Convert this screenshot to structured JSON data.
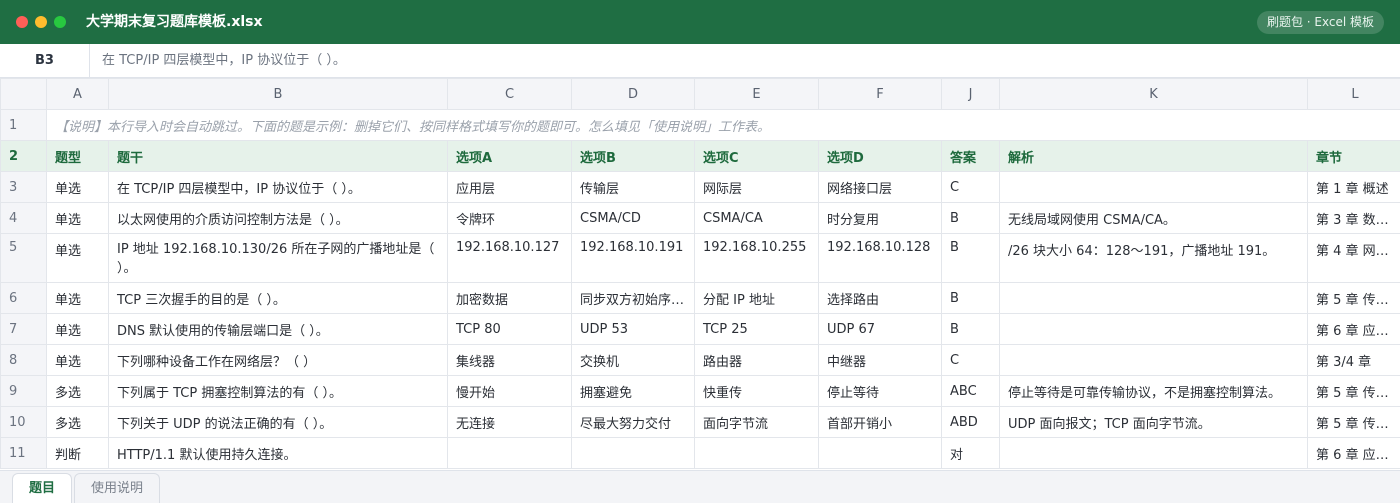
{
  "window": {
    "title": "大学期末复习题库模板.xlsx",
    "badge": "刷题包 · Excel 模板"
  },
  "formula_bar": {
    "cell_ref": "B3",
    "content": "在 TCP/IP 四层模型中，IP 协议位于（ ）。"
  },
  "columns": [
    "A",
    "B",
    "C",
    "D",
    "E",
    "F",
    "J",
    "K",
    "L"
  ],
  "note_row": {
    "num": "1",
    "text": "【说明】本行导入时会自动跳过。下面的题是示例：删掉它们、按同样格式填写你的题即可。怎么填见「使用说明」工作表。"
  },
  "header_row": {
    "num": "2",
    "cells": [
      "题型",
      "题干",
      "选项A",
      "选项B",
      "选项C",
      "选项D",
      "答案",
      "解析",
      "章节"
    ]
  },
  "rows": [
    {
      "num": "3",
      "cells": [
        "单选",
        "在 TCP/IP 四层模型中，IP 协议位于（ ）。",
        "应用层",
        "传输层",
        "网际层",
        "网络接口层",
        "C",
        "",
        "第 1 章 概述"
      ]
    },
    {
      "num": "4",
      "cells": [
        "单选",
        "以太网使用的介质访问控制方法是（ ）。",
        "令牌环",
        "CSMA/CD",
        "CSMA/CA",
        "时分复用",
        "B",
        "无线局域网使用 CSMA/CA。",
        "第 3 章 数…"
      ]
    },
    {
      "num": "5",
      "cells": [
        "单选",
        "IP 地址 192.168.10.130/26 所在子网的广播地址是（ ）。",
        "192.168.10.127",
        "192.168.10.191",
        "192.168.10.255",
        "192.168.10.128",
        "B",
        "/26 块大小 64：128～191，广播地址 191。",
        "第 4 章 网…"
      ]
    },
    {
      "num": "6",
      "cells": [
        "单选",
        "TCP 三次握手的目的是（ ）。",
        "加密数据",
        "同步双方初始序…",
        "分配 IP 地址",
        "选择路由",
        "B",
        "",
        "第 5 章 传…"
      ]
    },
    {
      "num": "7",
      "cells": [
        "单选",
        "DNS 默认使用的传输层端口是（ ）。",
        "TCP 80",
        "UDP 53",
        "TCP 25",
        "UDP 67",
        "B",
        "",
        "第 6 章 应…"
      ]
    },
    {
      "num": "8",
      "cells": [
        "单选",
        "下列哪种设备工作在网络层？（ ）",
        "集线器",
        "交换机",
        "路由器",
        "中继器",
        "C",
        "",
        "第 3/4 章"
      ]
    },
    {
      "num": "9",
      "cells": [
        "多选",
        "下列属于 TCP 拥塞控制算法的有（ ）。",
        "慢开始",
        "拥塞避免",
        "快重传",
        "停止等待",
        "ABC",
        "停止等待是可靠传输协议，不是拥塞控制算法。",
        "第 5 章 传…"
      ]
    },
    {
      "num": "10",
      "cells": [
        "多选",
        "下列关于 UDP 的说法正确的有（ ）。",
        "无连接",
        "尽最大努力交付",
        "面向字节流",
        "首部开销小",
        "ABD",
        "UDP 面向报文；TCP 面向字节流。",
        "第 5 章 传…"
      ]
    },
    {
      "num": "11",
      "cells": [
        "判断",
        "HTTP/1.1 默认使用持久连接。",
        "",
        "",
        "",
        "",
        "对",
        "",
        "第 6 章 应…"
      ]
    }
  ],
  "tabs": [
    {
      "label": "题目",
      "active": true
    },
    {
      "label": "使用说明",
      "active": false
    }
  ],
  "colors": {
    "titlebar": "#1f6e43",
    "header_row_bg": "#e6f2ea",
    "header_row_text": "#1e6a3d",
    "grid_line": "#e3e6eb",
    "row_col_header_bg": "#f4f5f8"
  }
}
